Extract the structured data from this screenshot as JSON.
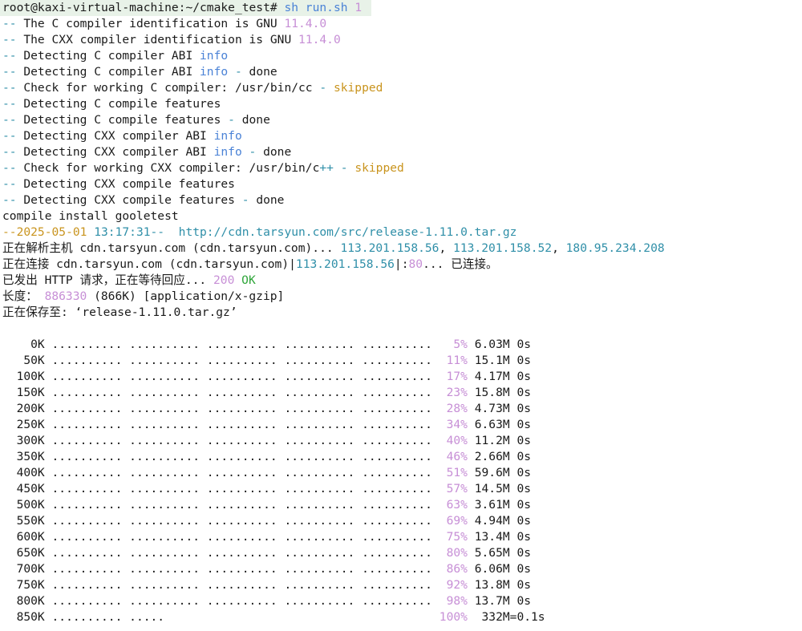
{
  "colors": {
    "background": "#ffffff",
    "text": "#1a1a1a",
    "cmake_prefix": "#2f8fa8",
    "version": "#c78fd6",
    "info": "#4a82d6",
    "skipped": "#c9941e",
    "timestamp": "#2f8fa8",
    "url": "#2f8fa8",
    "ok": "#2fa63a",
    "percent": "#c78fd6",
    "prompt_highlight": "#e8f2e8"
  },
  "lines": [
    [
      {
        "t": "root@kaxi-virtual-machine:~/cmake_test# "
      },
      {
        "t": "sh run.sh",
        "c": "info"
      },
      {
        "t": " 1",
        "c": "version"
      }
    ],
    [
      {
        "t": "-- ",
        "c": "cmake_prefix"
      },
      {
        "t": "The C compiler identification is GNU "
      },
      {
        "t": "11.4.0",
        "c": "version"
      }
    ],
    [
      {
        "t": "-- ",
        "c": "cmake_prefix"
      },
      {
        "t": "The CXX compiler identification is GNU "
      },
      {
        "t": "11.4.0",
        "c": "version"
      }
    ],
    [
      {
        "t": "-- ",
        "c": "cmake_prefix"
      },
      {
        "t": "Detecting C compiler ABI "
      },
      {
        "t": "info",
        "c": "info"
      }
    ],
    [
      {
        "t": "-- ",
        "c": "cmake_prefix"
      },
      {
        "t": "Detecting C compiler ABI "
      },
      {
        "t": "info",
        "c": "info"
      },
      {
        "t": " - ",
        "c": "cmake_prefix"
      },
      {
        "t": "done"
      }
    ],
    [
      {
        "t": "-- ",
        "c": "cmake_prefix"
      },
      {
        "t": "Check for working C compiler: /usr/bin/cc"
      },
      {
        "t": " - ",
        "c": "cmake_prefix"
      },
      {
        "t": "skipped",
        "c": "skipped"
      }
    ],
    [
      {
        "t": "-- ",
        "c": "cmake_prefix"
      },
      {
        "t": "Detecting C compile features"
      }
    ],
    [
      {
        "t": "-- ",
        "c": "cmake_prefix"
      },
      {
        "t": "Detecting C compile features"
      },
      {
        "t": " - ",
        "c": "cmake_prefix"
      },
      {
        "t": "done"
      }
    ],
    [
      {
        "t": "-- ",
        "c": "cmake_prefix"
      },
      {
        "t": "Detecting CXX compiler ABI "
      },
      {
        "t": "info",
        "c": "info"
      }
    ],
    [
      {
        "t": "-- ",
        "c": "cmake_prefix"
      },
      {
        "t": "Detecting CXX compiler ABI "
      },
      {
        "t": "info",
        "c": "info"
      },
      {
        "t": " - ",
        "c": "cmake_prefix"
      },
      {
        "t": "done"
      }
    ],
    [
      {
        "t": "-- ",
        "c": "cmake_prefix"
      },
      {
        "t": "Check for working CXX compiler: /usr/bin/c"
      },
      {
        "t": "++",
        "c": "cmake_prefix"
      },
      {
        "t": " - ",
        "c": "cmake_prefix"
      },
      {
        "t": "skipped",
        "c": "skipped"
      }
    ],
    [
      {
        "t": "-- ",
        "c": "cmake_prefix"
      },
      {
        "t": "Detecting CXX compile features"
      }
    ],
    [
      {
        "t": "-- ",
        "c": "cmake_prefix"
      },
      {
        "t": "Detecting CXX compile features"
      },
      {
        "t": " - ",
        "c": "cmake_prefix"
      },
      {
        "t": "done"
      }
    ],
    [
      {
        "t": "compile install gooletest"
      }
    ],
    [
      {
        "t": "--2025-05-01",
        "c": "skipped"
      },
      {
        "t": " 13:17:31--  http://cdn.tarsyun.com/src/release-1.11.0.tar.gz",
        "c": "url"
      }
    ],
    [
      {
        "t": "正在解析主机 cdn.tarsyun.com (cdn.tarsyun.com)... "
      },
      {
        "t": "113.201.158.56",
        "c": "url"
      },
      {
        "t": ", "
      },
      {
        "t": "113.201.158.52",
        "c": "url"
      },
      {
        "t": ", "
      },
      {
        "t": "180.95.234.208",
        "c": "url"
      }
    ],
    [
      {
        "t": "正在连接 cdn.tarsyun.com (cdn.tarsyun.com)|"
      },
      {
        "t": "113.201.158.56",
        "c": "url"
      },
      {
        "t": "|:"
      },
      {
        "t": "80",
        "c": "version"
      },
      {
        "t": "... 已连接。"
      }
    ],
    [
      {
        "t": "已发出 HTTP 请求，正在等待回应... "
      },
      {
        "t": "200",
        "c": "version"
      },
      {
        "t": " "
      },
      {
        "t": "OK",
        "c": "ok"
      }
    ],
    [
      {
        "t": "长度： "
      },
      {
        "t": "886330",
        "c": "version"
      },
      {
        "t": " (866K) [application/x-gzip]"
      }
    ],
    [
      {
        "t": "正在保存至: ‘release-1.11.0.tar.gz’"
      }
    ],
    [
      {
        "t": ""
      }
    ]
  ],
  "progress": {
    "rows": [
      {
        "offset": "    0K",
        "dots": ".......... .......... .......... .......... ..........",
        "pct": "  5%",
        "rate": " 6.03M 0s"
      },
      {
        "offset": "   50K",
        "dots": ".......... .......... .......... .......... ..........",
        "pct": " 11%",
        "rate": " 15.1M 0s"
      },
      {
        "offset": "  100K",
        "dots": ".......... .......... .......... .......... ..........",
        "pct": " 17%",
        "rate": " 4.17M 0s"
      },
      {
        "offset": "  150K",
        "dots": ".......... .......... .......... .......... ..........",
        "pct": " 23%",
        "rate": " 15.8M 0s"
      },
      {
        "offset": "  200K",
        "dots": ".......... .......... .......... .......... ..........",
        "pct": " 28%",
        "rate": " 4.73M 0s"
      },
      {
        "offset": "  250K",
        "dots": ".......... .......... .......... .......... ..........",
        "pct": " 34%",
        "rate": " 6.63M 0s"
      },
      {
        "offset": "  300K",
        "dots": ".......... .......... .......... .......... ..........",
        "pct": " 40%",
        "rate": " 11.2M 0s"
      },
      {
        "offset": "  350K",
        "dots": ".......... .......... .......... .......... ..........",
        "pct": " 46%",
        "rate": " 2.66M 0s"
      },
      {
        "offset": "  400K",
        "dots": ".......... .......... .......... .......... ..........",
        "pct": " 51%",
        "rate": " 59.6M 0s"
      },
      {
        "offset": "  450K",
        "dots": ".......... .......... .......... .......... ..........",
        "pct": " 57%",
        "rate": " 14.5M 0s"
      },
      {
        "offset": "  500K",
        "dots": ".......... .......... .......... .......... ..........",
        "pct": " 63%",
        "rate": " 3.61M 0s"
      },
      {
        "offset": "  550K",
        "dots": ".......... .......... .......... .......... ..........",
        "pct": " 69%",
        "rate": " 4.94M 0s"
      },
      {
        "offset": "  600K",
        "dots": ".......... .......... .......... .......... ..........",
        "pct": " 75%",
        "rate": " 13.4M 0s"
      },
      {
        "offset": "  650K",
        "dots": ".......... .......... .......... .......... ..........",
        "pct": " 80%",
        "rate": " 5.65M 0s"
      },
      {
        "offset": "  700K",
        "dots": ".......... .......... .......... .......... ..........",
        "pct": " 86%",
        "rate": " 6.06M 0s"
      },
      {
        "offset": "  750K",
        "dots": ".......... .......... .......... .......... ..........",
        "pct": " 92%",
        "rate": " 13.8M 0s"
      },
      {
        "offset": "  800K",
        "dots": ".......... .......... .......... .......... ..........",
        "pct": " 98%",
        "rate": " 13.7M 0s"
      },
      {
        "offset": "  850K",
        "dots": ".......... .....                                      ",
        "pct": "100%",
        "rate": "  332M=0.1s"
      }
    ]
  }
}
